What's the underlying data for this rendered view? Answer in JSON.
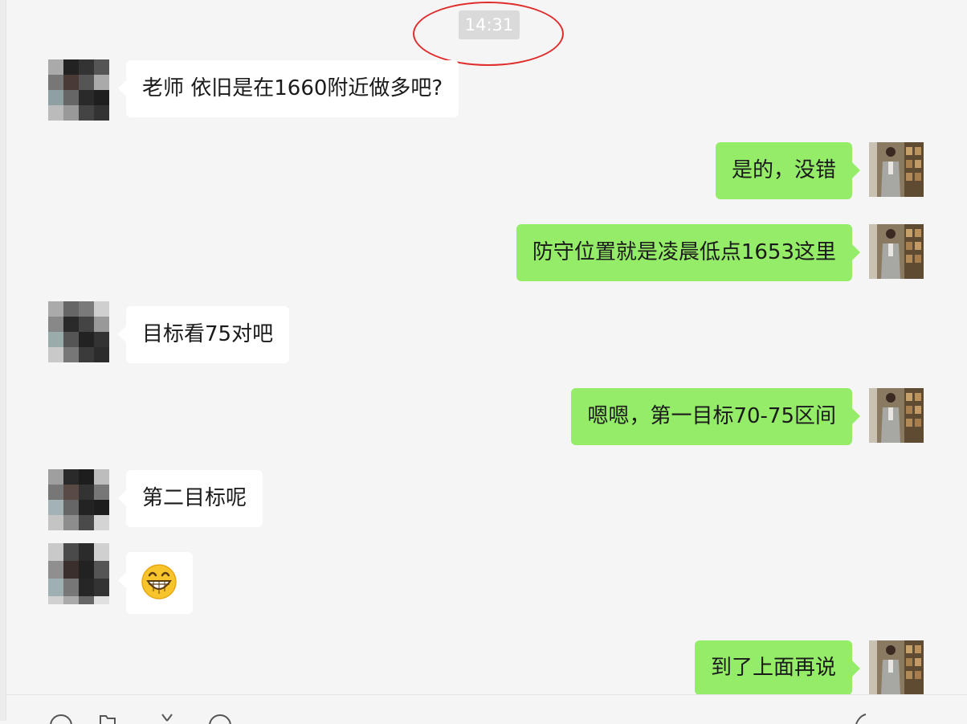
{
  "chat": {
    "timestamp": "14:31",
    "messages": [
      {
        "side": "in",
        "text": "老师 依旧是在1660附近做多吧?"
      },
      {
        "side": "out",
        "text": "是的，没错"
      },
      {
        "side": "out",
        "text": "防守位置就是凌晨低点1653这里"
      },
      {
        "side": "in",
        "text": "目标看75对吧"
      },
      {
        "side": "out",
        "text": "嗯嗯，第一目标70-75区间"
      },
      {
        "side": "in",
        "text": "第二目标呢"
      },
      {
        "side": "in",
        "emoji": "grinning-face-emoji"
      },
      {
        "side": "out",
        "text": "到了上面再说"
      }
    ]
  },
  "colors": {
    "background": "#f5f5f5",
    "incoming_bubble": "#ffffff",
    "outgoing_bubble": "#95ec69",
    "timestamp_bg": "#dadada",
    "annotation_circle": "#e02b2b"
  },
  "icons": {
    "toolbar": [
      "emoji-icon",
      "folder-icon",
      "scissors-icon",
      "chat-history-icon",
      "phone-icon"
    ]
  }
}
